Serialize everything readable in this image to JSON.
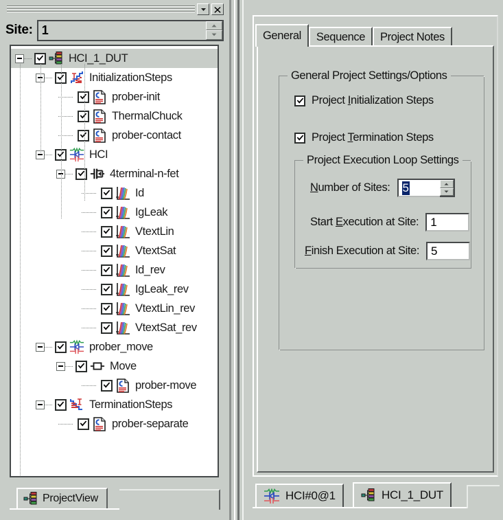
{
  "window": {
    "titlebar": {
      "minimize_label": "▾",
      "close_label": "✕"
    },
    "site": {
      "label": "Site:",
      "value": "1"
    }
  },
  "tree": {
    "items": [
      {
        "label": "HCI_1_DUT",
        "level": 0,
        "icon": "project-node-icon",
        "expander": "minus",
        "checked": true,
        "selected": true
      },
      {
        "label": "InitializationSteps",
        "level": 1,
        "icon": "init-steps-icon",
        "expander": "minus",
        "checked": true,
        "selected": false
      },
      {
        "label": "prober-init",
        "level": 2,
        "icon": "script-doc-icon",
        "expander": "none",
        "checked": true,
        "selected": false
      },
      {
        "label": "ThermalChuck",
        "level": 2,
        "icon": "script-doc-icon",
        "expander": "none",
        "checked": true,
        "selected": false
      },
      {
        "label": "prober-contact",
        "level": 2,
        "icon": "script-doc-icon",
        "expander": "none",
        "checked": true,
        "selected": false
      },
      {
        "label": "HCI",
        "level": 1,
        "icon": "device-circuit-icon",
        "expander": "minus",
        "checked": true,
        "selected": false
      },
      {
        "label": "4terminal-n-fet",
        "level": 2,
        "icon": "transistor-icon",
        "expander": "minus",
        "checked": true,
        "selected": false
      },
      {
        "label": "Id",
        "level": 3,
        "icon": "graph-plot-icon",
        "expander": "none",
        "checked": true,
        "selected": false
      },
      {
        "label": "IgLeak",
        "level": 3,
        "icon": "graph-plot-icon",
        "expander": "none",
        "checked": true,
        "selected": false
      },
      {
        "label": "VtextLin",
        "level": 3,
        "icon": "graph-plot-icon",
        "expander": "none",
        "checked": true,
        "selected": false
      },
      {
        "label": "VtextSat",
        "level": 3,
        "icon": "graph-plot-icon",
        "expander": "none",
        "checked": true,
        "selected": false
      },
      {
        "label": "Id_rev",
        "level": 3,
        "icon": "graph-plot-icon",
        "expander": "none",
        "checked": true,
        "selected": false
      },
      {
        "label": "IgLeak_rev",
        "level": 3,
        "icon": "graph-plot-icon",
        "expander": "none",
        "checked": true,
        "selected": false
      },
      {
        "label": "VtextLin_rev",
        "level": 3,
        "icon": "graph-plot-icon",
        "expander": "none",
        "checked": true,
        "selected": false
      },
      {
        "label": "VtextSat_rev",
        "level": 3,
        "icon": "graph-plot-icon",
        "expander": "none",
        "checked": true,
        "selected": false
      },
      {
        "label": "prober_move",
        "level": 1,
        "icon": "device-circuit-icon",
        "expander": "minus",
        "checked": true,
        "selected": false
      },
      {
        "label": "Move",
        "level": 2,
        "icon": "move-node-icon",
        "expander": "minus",
        "checked": true,
        "selected": false
      },
      {
        "label": "prober-move",
        "level": 3,
        "icon": "script-doc-icon",
        "expander": "none",
        "checked": true,
        "selected": false
      },
      {
        "label": "TerminationSteps",
        "level": 1,
        "icon": "term-steps-icon",
        "expander": "minus",
        "checked": true,
        "selected": false
      },
      {
        "label": "prober-separate",
        "level": 2,
        "icon": "script-doc-icon",
        "expander": "none",
        "checked": true,
        "selected": false
      }
    ]
  },
  "left_bottom_tabs": [
    {
      "label": "ProjectView",
      "icon": "project-node-icon",
      "active": true
    }
  ],
  "right_panel": {
    "tabs": [
      {
        "label": "General",
        "active": true
      },
      {
        "label": "Sequence",
        "active": false
      },
      {
        "label": "Project Notes",
        "active": false
      }
    ],
    "general_group": {
      "title": "General Project Settings/Options",
      "checkboxes": [
        {
          "label_pre": "Project ",
          "label_accel": "I",
          "label_post": "nitialization Steps",
          "checked": true
        },
        {
          "label_pre": "Project ",
          "label_accel": "T",
          "label_post": "ermination Steps",
          "checked": true
        }
      ],
      "loop_group": {
        "title": "Project Execution Loop Settings",
        "fields": [
          {
            "label_accel": "N",
            "label_pre": "",
            "label_post": "umber of Sites:",
            "value": "5",
            "type": "spinner",
            "selected": true
          },
          {
            "label_accel": "E",
            "label_pre": "Start ",
            "label_post": "xecution at Site:",
            "value": "1",
            "type": "text",
            "selected": false
          },
          {
            "label_accel": "F",
            "label_pre": "",
            "label_post": "inish Execution at Site:",
            "value": "5",
            "type": "text",
            "selected": false
          }
        ]
      }
    }
  },
  "right_bottom_tabs": [
    {
      "label": "HCI#0@1",
      "icon": "device-circuit-icon",
      "active": false
    },
    {
      "label": "HCI_1_DUT",
      "icon": "project-node-icon",
      "active": true
    }
  ],
  "colors": {
    "face": "#c8cdc8",
    "selection": "#0a246a",
    "window": "#ffffff",
    "shadow": "#45494a"
  }
}
